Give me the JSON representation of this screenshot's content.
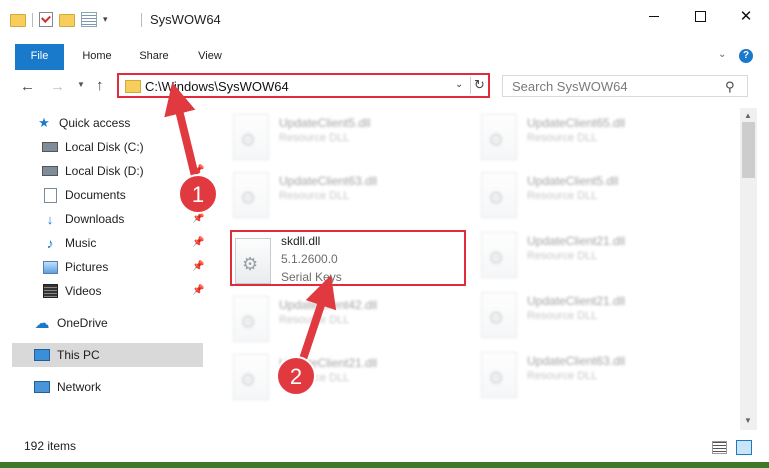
{
  "window": {
    "title": "SysWOW64",
    "controls": {
      "minimize": "minimize",
      "maximize": "maximize",
      "close": "✕"
    }
  },
  "ribbon": {
    "tabs": [
      "File",
      "Home",
      "Share",
      "View"
    ],
    "help": "?"
  },
  "address_bar": {
    "path": "C:\\Windows\\SysWOW64"
  },
  "search": {
    "placeholder": "Search SysWOW64"
  },
  "sidebar": {
    "items": [
      {
        "label": "Quick access",
        "icon": "star-icon"
      },
      {
        "label": "Local Disk (C:)",
        "icon": "drive-icon",
        "pinned": true
      },
      {
        "label": "Local Disk (D:)",
        "icon": "drive-icon",
        "pinned": true
      },
      {
        "label": "Documents",
        "icon": "documents-icon",
        "pinned": true
      },
      {
        "label": "Downloads",
        "icon": "download-icon",
        "pinned": true
      },
      {
        "label": "Music",
        "icon": "music-icon",
        "pinned": true
      },
      {
        "label": "Pictures",
        "icon": "pictures-icon",
        "pinned": true
      },
      {
        "label": "Videos",
        "icon": "videos-icon",
        "pinned": true
      },
      {
        "label": "OneDrive",
        "icon": "onedrive-icon"
      },
      {
        "label": "This PC",
        "icon": "computer-icon",
        "selected": true
      },
      {
        "label": "Network",
        "icon": "network-icon"
      }
    ]
  },
  "files": {
    "left": [
      {
        "name": "UpdateClient5.dll",
        "sub": "Resource DLL"
      },
      {
        "name": "UpdateClient63.dll",
        "sub": "Resource DLL"
      },
      {
        "name": "skdll.dll",
        "version": "5.1.2600.0",
        "description": "Serial Keys"
      },
      {
        "name": "UpdateClient42.dll",
        "sub": "Resource DLL"
      },
      {
        "name": "UpdateClient21.dll",
        "sub": "Resource DLL"
      }
    ],
    "right": [
      {
        "name": "UpdateClient65.dll",
        "sub": "Resource DLL"
      },
      {
        "name": "UpdateClient5.dll",
        "sub": "Resource DLL"
      },
      {
        "name": "UpdateClient21.dll",
        "sub": "Resource DLL"
      },
      {
        "name": "UpdateClient21.dll",
        "sub": "Resource DLL"
      },
      {
        "name": "UpdateClient63.dll",
        "sub": "Resource DLL"
      }
    ]
  },
  "status": {
    "item_count": "192 items"
  },
  "annotations": {
    "badge1": "1",
    "badge2": "2",
    "highlight_color": "#e02b3a"
  }
}
